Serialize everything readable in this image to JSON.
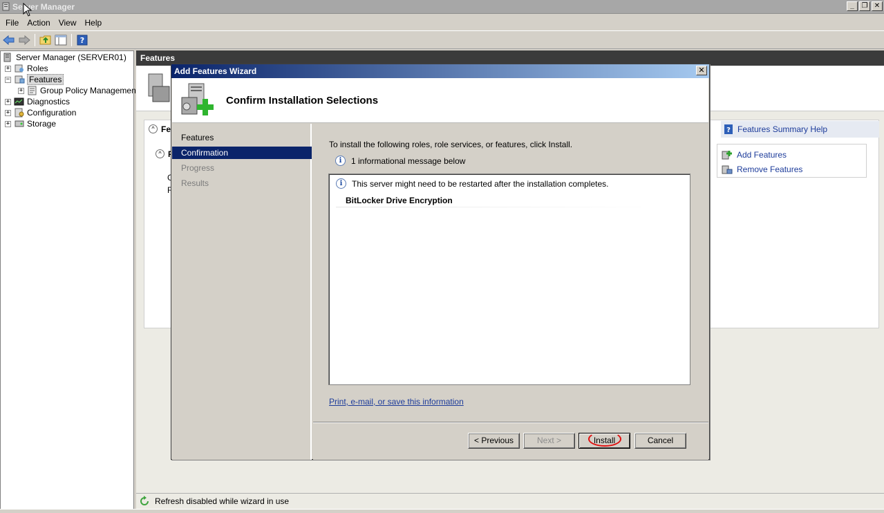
{
  "window": {
    "title": "Server Manager",
    "controls": [
      "_",
      "❐",
      "✕"
    ]
  },
  "menubar": [
    "File",
    "Action",
    "View",
    "Help"
  ],
  "toolbar": {
    "icons": [
      "back-arrow-icon",
      "forward-arrow-icon",
      "up-folder-icon",
      "show-hide-tree-icon",
      "help-icon"
    ]
  },
  "tree": {
    "root": "Server Manager (SERVER01)",
    "items": [
      {
        "label": "Roles",
        "expander": "+"
      },
      {
        "label": "Features",
        "expander": "−"
      },
      {
        "label": "Group Policy Management",
        "expander": "+"
      },
      {
        "label": "Diagnostics",
        "expander": "+"
      },
      {
        "label": "Configuration",
        "expander": "+"
      },
      {
        "label": "Storage",
        "expander": "+"
      }
    ]
  },
  "main": {
    "header": "Features",
    "section_title_fragment": "Fea",
    "subsection_fragment": "F",
    "frag_g": "G",
    "frag_r": "R",
    "help_link": "Features Summary Help",
    "actions": [
      "Add Features",
      "Remove Features"
    ]
  },
  "status": {
    "text": "Refresh disabled while wizard in use"
  },
  "wizard": {
    "title": "Add Features Wizard",
    "close": "✕",
    "heading": "Confirm Installation Selections",
    "nav": [
      {
        "label": "Features",
        "state": "normal"
      },
      {
        "label": "Confirmation",
        "state": "selected"
      },
      {
        "label": "Progress",
        "state": "disabled"
      },
      {
        "label": "Results",
        "state": "disabled"
      }
    ],
    "instructions": "To install the following roles, role services, or features, click Install.",
    "info_summary": "1 informational message below",
    "info_glyph": "i",
    "list": {
      "message": "This server might need to be restarted after the installation completes.",
      "feature": "BitLocker Drive Encryption"
    },
    "print_link": "Print, e-mail, or save this information",
    "buttons": {
      "previous": "< Previous",
      "next": "Next >",
      "install": "Install",
      "cancel": "Cancel"
    }
  }
}
